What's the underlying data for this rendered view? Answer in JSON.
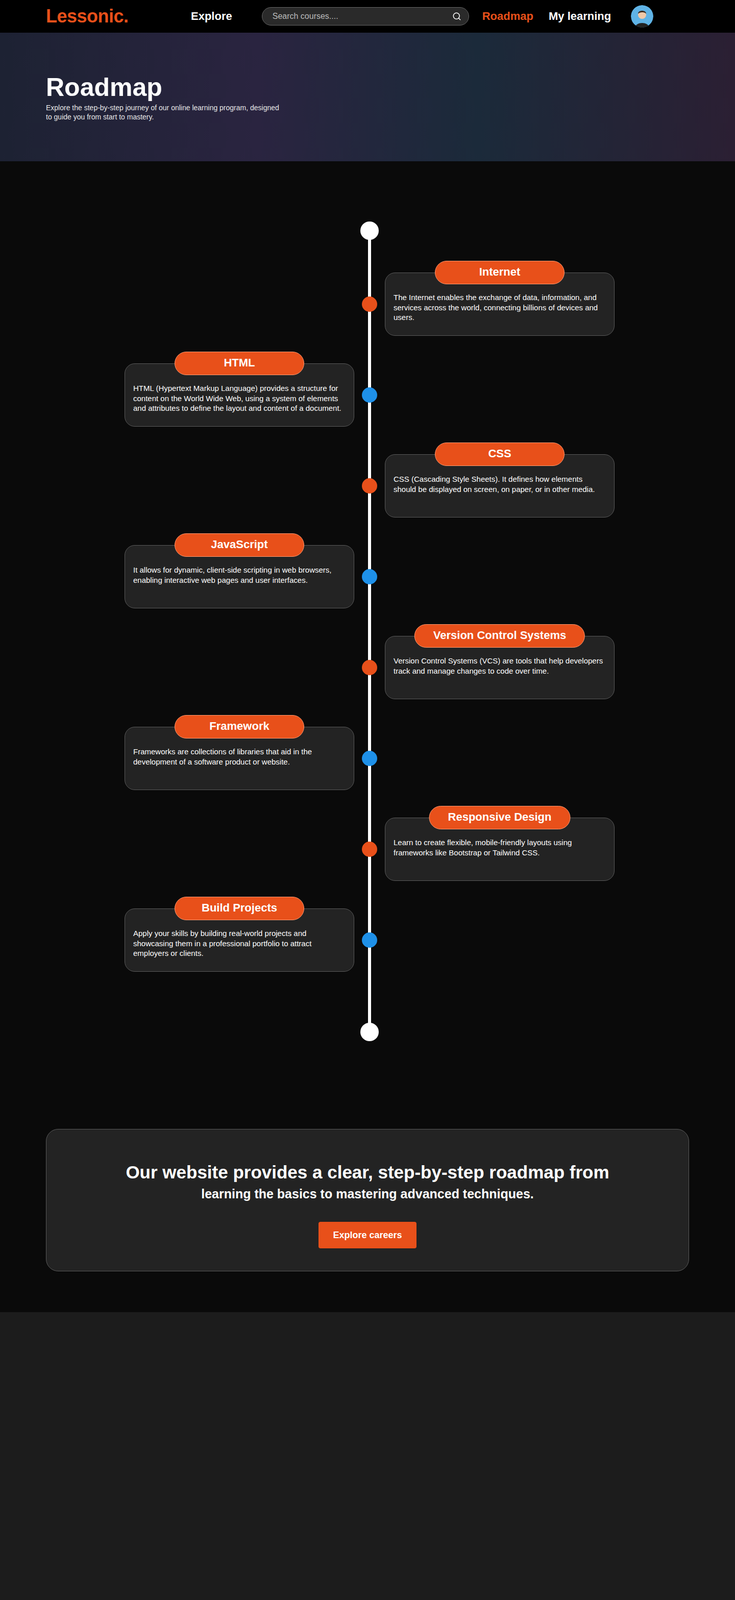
{
  "header": {
    "logo": "Lessonic.",
    "nav": [
      {
        "label": "Explore",
        "selected": false
      },
      {
        "label": "Roadmap",
        "selected": true
      },
      {
        "label": "My learning",
        "selected": false
      }
    ],
    "search": {
      "placeholder": "Search courses...."
    }
  },
  "hero": {
    "title": "Roadmap",
    "subtitle": "Explore the step-by-step journey of our online learning program, designed to guide you from start to mastery."
  },
  "roadmap": [
    {
      "title": "Internet",
      "text": "The Internet enables the exchange of data, information, and services across the world, connecting billions of devices and users.",
      "color": "#e8501a"
    },
    {
      "title": "HTML",
      "text": "HTML (Hypertext Markup Language) provides a structure for content on the World Wide Web, using a system of elements and attributes to define the layout and content of a document.",
      "color": "#1e90e8"
    },
    {
      "title": "CSS",
      "text": "CSS (Cascading Style Sheets). It defines how elements should be displayed on screen, on paper, or in other media.",
      "color": "#e8501a"
    },
    {
      "title": "JavaScript",
      "text": "It allows for dynamic, client-side scripting in web browsers, enabling interactive web pages and user interfaces.",
      "color": "#1e90e8"
    },
    {
      "title": "Version Control Systems",
      "text": "Version Control Systems (VCS) are tools that help developers track and manage changes to code over time.",
      "color": "#e8501a"
    },
    {
      "title": "Framework",
      "text": "Frameworks are collections of libraries that aid in the development of a software product or website.",
      "color": "#1e90e8"
    },
    {
      "title": "Responsive Design",
      "text": "Learn to create flexible, mobile-friendly layouts using frameworks like Bootstrap or Tailwind CSS.",
      "color": "#e8501a"
    },
    {
      "title": "Build Projects",
      "text": "Apply your skills by building real-world projects and showcasing them in a professional portfolio to attract employers or clients.",
      "color": "#1e90e8"
    }
  ],
  "cta": {
    "title": "Our website provides a clear, step-by-step roadmap from",
    "subtitle": "learning the basics to mastering advanced techniques.",
    "button": "Explore careers"
  }
}
